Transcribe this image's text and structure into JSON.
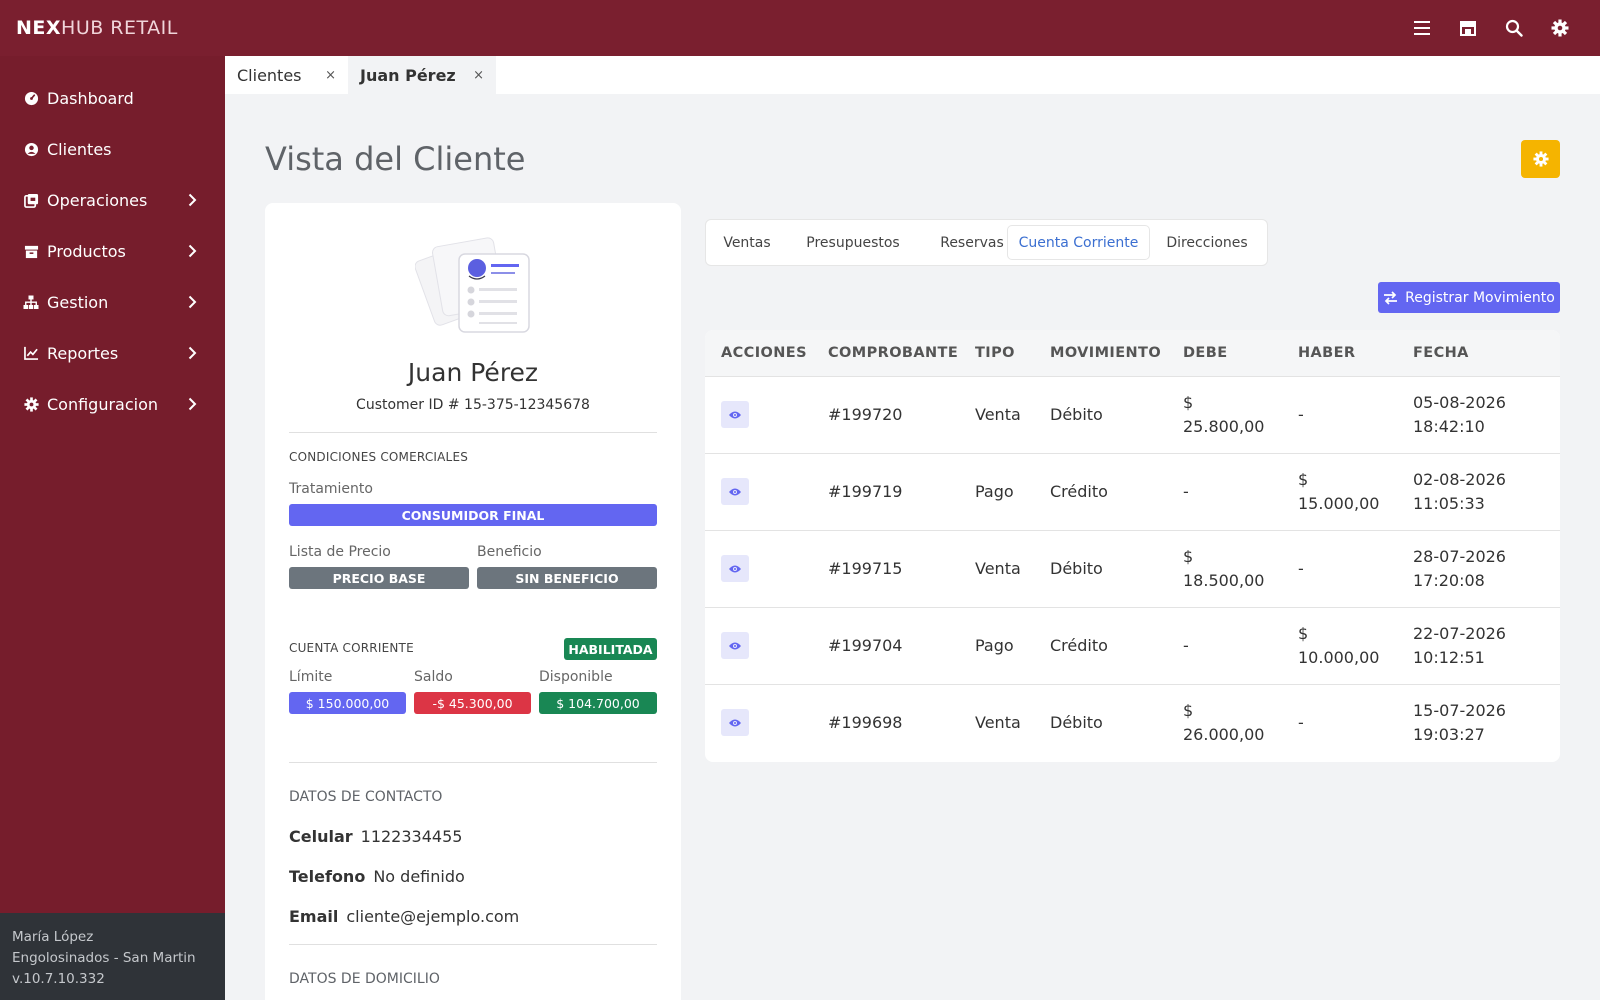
{
  "app": {
    "brand_bold": "NEX",
    "brand_light": "HUB RETAIL"
  },
  "topbar": {
    "icons": [
      "menu-icon",
      "store-icon",
      "search-icon",
      "gear-icon"
    ]
  },
  "sidebar": {
    "items": [
      {
        "label": "Dashboard",
        "icon": "dashboard-icon",
        "has_children": false
      },
      {
        "label": "Clientes",
        "icon": "user-circle-icon",
        "has_children": false
      },
      {
        "label": "Operaciones",
        "icon": "operations-icon",
        "has_children": true
      },
      {
        "label": "Productos",
        "icon": "archive-icon",
        "has_children": true
      },
      {
        "label": "Gestion",
        "icon": "sitemap-icon",
        "has_children": true
      },
      {
        "label": "Reportes",
        "icon": "chart-line-icon",
        "has_children": true
      },
      {
        "label": "Configuracion",
        "icon": "cog-icon",
        "has_children": true
      }
    ],
    "footer": {
      "user": "María López",
      "store": "Engolosinados - San Martin",
      "version": "v.10.7.10.332"
    }
  },
  "tabs": [
    {
      "label": "Clientes",
      "active": false,
      "close": "×"
    },
    {
      "label": "Juan Pérez",
      "active": true,
      "close": "×"
    }
  ],
  "page": {
    "title": "Vista del Cliente"
  },
  "customer": {
    "name": "Juan Pérez",
    "customer_id": "Customer ID # 15-375-12345678",
    "commercial": {
      "section_title": "CONDICIONES COMERCIALES",
      "treatment_label": "Tratamiento",
      "treatment_value": "CONSUMIDOR FINAL",
      "price_list_label": "Lista de Precio",
      "price_list_value": "PRECIO BASE",
      "benefit_label": "Beneficio",
      "benefit_value": "SIN BENEFICIO"
    },
    "account": {
      "section_title": "CUENTA CORRIENTE",
      "status": "HABILITADA",
      "limit_label": "Límite",
      "limit_value": "$ 150.000,00",
      "balance_label": "Saldo",
      "balance_value": "-$ 45.300,00",
      "available_label": "Disponible",
      "available_value": "$ 104.700,00"
    },
    "contact": {
      "section_title": "DATOS DE CONTACTO",
      "mobile_label": "Celular",
      "mobile_value": "1122334455",
      "phone_label": "Telefono",
      "phone_value": "No definido",
      "email_label": "Email",
      "email_value": "cliente@ejemplo.com"
    },
    "address": {
      "section_title": "DATOS DE DOMICILIO"
    }
  },
  "detail_tabs": [
    {
      "label": "Ventas",
      "active": false
    },
    {
      "label": "Presupuestos",
      "active": false
    },
    {
      "label": "Reservas",
      "active": false
    },
    {
      "label": "Cuenta Corriente",
      "active": true
    },
    {
      "label": "Direcciones",
      "active": false
    }
  ],
  "register_button": {
    "label": "Registrar Movimiento",
    "icon": "exchange-icon"
  },
  "movements": {
    "columns": [
      "ACCIONES",
      "COMPROBANTE",
      "TIPO",
      "MOVIMIENTO",
      "DEBE",
      "HABER",
      "FECHA"
    ],
    "rows": [
      {
        "voucher": "#199720",
        "type": "Venta",
        "movement": "Débito",
        "debit_sym": "$",
        "debit": "25.800,00",
        "credit_sym": "-",
        "credit": "",
        "date": "05-08-2026",
        "time": "18:42:10"
      },
      {
        "voucher": "#199719",
        "type": "Pago",
        "movement": "Crédito",
        "debit_sym": "-",
        "debit": "",
        "credit_sym": "$",
        "credit": "15.000,00",
        "date": "02-08-2026",
        "time": "11:05:33"
      },
      {
        "voucher": "#199715",
        "type": "Venta",
        "movement": "Débito",
        "debit_sym": "$",
        "debit": "18.500,00",
        "credit_sym": "-",
        "credit": "",
        "date": "28-07-2026",
        "time": "17:20:08"
      },
      {
        "voucher": "#199704",
        "type": "Pago",
        "movement": "Crédito",
        "debit_sym": "-",
        "debit": "",
        "credit_sym": "$",
        "credit": "10.000,00",
        "date": "22-07-2026",
        "time": "10:12:51"
      },
      {
        "voucher": "#199698",
        "type": "Venta",
        "movement": "Débito",
        "debit_sym": "$",
        "debit": "26.000,00",
        "credit_sym": "-",
        "credit": "",
        "date": "15-07-2026",
        "time": "19:03:27"
      }
    ]
  },
  "colors": {
    "topbar": "#7a1f2f",
    "sidebar": "#761d2c",
    "accent_purple": "#6366f1",
    "warning": "#f5b400",
    "success": "#198754",
    "danger": "#dc3545",
    "neutral_badge": "#6c757d",
    "link_blue": "#3b6fd1"
  }
}
